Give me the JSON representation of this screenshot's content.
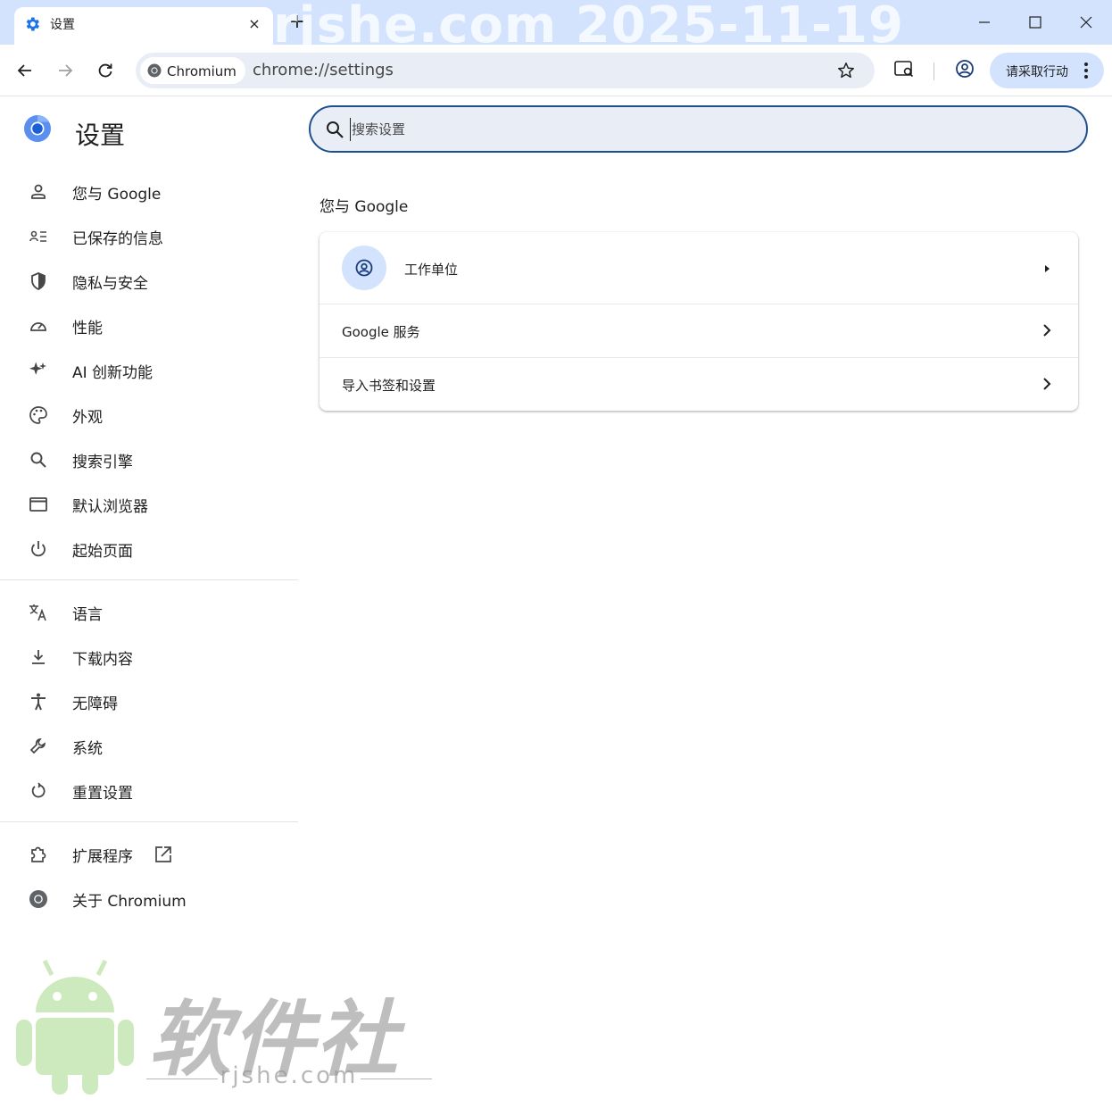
{
  "tab": {
    "title": "设置",
    "close": "×",
    "new_tab": "+"
  },
  "watermark_top": "rjshe.com 2025-11-19",
  "toolbar": {
    "chip_label": "Chromium",
    "url": "chrome://settings",
    "action_label": "请采取行动"
  },
  "sidebar": {
    "title": "设置",
    "items": [
      {
        "label": "您与 Google",
        "icon": "person-icon"
      },
      {
        "label": "已保存的信息",
        "icon": "saved-info-icon"
      },
      {
        "label": "隐私与安全",
        "icon": "shield-icon"
      },
      {
        "label": "性能",
        "icon": "speedometer-icon"
      },
      {
        "label": "AI 创新功能",
        "icon": "sparkle-icon"
      },
      {
        "label": "外观",
        "icon": "palette-icon"
      },
      {
        "label": "搜索引擎",
        "icon": "search-icon"
      },
      {
        "label": "默认浏览器",
        "icon": "browser-window-icon"
      },
      {
        "label": "起始页面",
        "icon": "power-icon"
      },
      {
        "label": "语言",
        "icon": "translate-icon"
      },
      {
        "label": "下载内容",
        "icon": "download-icon"
      },
      {
        "label": "无障碍",
        "icon": "accessibility-icon"
      },
      {
        "label": "系统",
        "icon": "wrench-icon"
      },
      {
        "label": "重置设置",
        "icon": "reset-icon"
      },
      {
        "label": "扩展程序",
        "icon": "puzzle-icon"
      },
      {
        "label": "关于 Chromium",
        "icon": "chromium-icon"
      }
    ]
  },
  "search": {
    "placeholder": "搜索设置"
  },
  "main": {
    "section_title": "您与 Google",
    "rows": [
      {
        "label": "工作单位"
      },
      {
        "label": "Google 服务"
      },
      {
        "label": "导入书签和设置"
      }
    ]
  },
  "watermark_bottom": {
    "brand": "软件社",
    "url": "rjshe.com"
  },
  "colors": {
    "tabstrip": "#d3e3fd",
    "accent": "#1f4f8f",
    "omnibox": "#e9eef6"
  }
}
